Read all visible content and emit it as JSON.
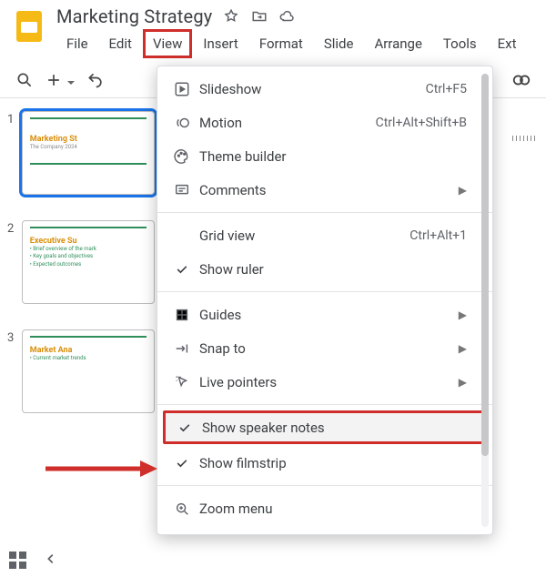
{
  "doc": {
    "title": "Marketing Strategy"
  },
  "menubar": {
    "items": [
      "File",
      "Edit",
      "View",
      "Insert",
      "Format",
      "Slide",
      "Arrange",
      "Tools",
      "Ext"
    ],
    "highlighted_index": 2
  },
  "slides": {
    "s1": {
      "num": "1",
      "title": "Marketing St",
      "sub": "The Company 2024"
    },
    "s2": {
      "num": "2",
      "title": "Executive Su",
      "b1": "• Brief overview of the mark",
      "b2": "• Key goals and objectives",
      "b3": "• Expected outcomes"
    },
    "s3": {
      "num": "3",
      "title": "Market Ana",
      "b1": "• Current market trends"
    }
  },
  "dropdown": {
    "slideshow": {
      "label": "Slideshow",
      "shortcut": "Ctrl+F5"
    },
    "motion": {
      "label": "Motion",
      "shortcut": "Ctrl+Alt+Shift+B"
    },
    "themebuilder": {
      "label": "Theme builder"
    },
    "comments": {
      "label": "Comments"
    },
    "gridview": {
      "label": "Grid view",
      "shortcut": "Ctrl+Alt+1"
    },
    "showruler": {
      "label": "Show ruler"
    },
    "guides": {
      "label": "Guides"
    },
    "snapto": {
      "label": "Snap to"
    },
    "livepointers": {
      "label": "Live pointers"
    },
    "speakernotes": {
      "label": "Show speaker notes"
    },
    "filmstrip": {
      "label": "Show filmstrip"
    },
    "zoommenu": {
      "label": "Zoom menu"
    }
  }
}
